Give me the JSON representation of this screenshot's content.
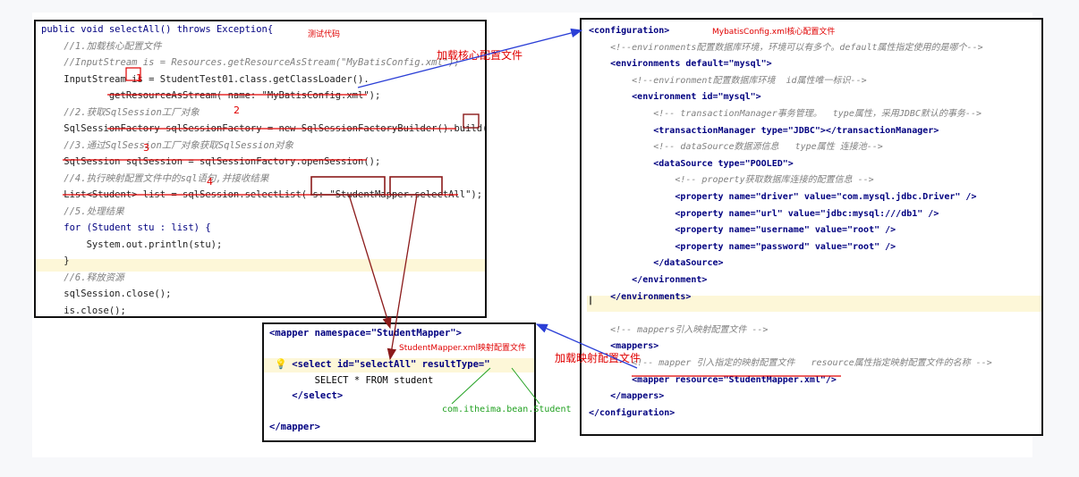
{
  "java": {
    "lines": [
      "public void selectAll() throws Exception{",
      "    //1.加载核心配置文件",
      "    //InputStream is = Resources.getResourceAsStream(\"MyBatisConfig.xml\");",
      "    InputStream is = StudentTest01.class.getClassLoader().",
      "            getResourceAsStream( name: \"MyBatisConfig.xml\");",
      "    //2.获取SqlSession工厂对象",
      "    SqlSessionFactory sqlSessionFactory = new SqlSessionFactoryBuilder().build(is);",
      "    //3.通过SqlSession工厂对象获取SqlSession对象",
      "    SqlSession sqlSession = sqlSessionFactory.openSession();",
      "    //4.执行映射配置文件中的sql语句,并接收结果",
      "    List<Student> list = sqlSession.selectList( s: \"StudentMapper.selectAll\");",
      "    //5.处理结果",
      "    for (Student stu : list) {",
      "        System.out.println(stu);",
      "    }",
      "    //6.释放资源",
      "    sqlSession.close();",
      "    is.close();",
      "}"
    ]
  },
  "config": {
    "lines": [
      "<configuration>",
      "    <!--environments配置数据库环境，环境可以有多个。default属性指定使用的是哪个-->",
      "    <environments default=\"mysql\">",
      "        <!--environment配置数据库环境  id属性唯一标识-->",
      "        <environment id=\"mysql\">",
      "            <!-- transactionManager事务管理。  type属性，采用JDBC默认的事务-->",
      "            <transactionManager type=\"JDBC\"></transactionManager>",
      "            <!-- dataSource数据源信息   type属性 连接池-->",
      "            <dataSource type=\"POOLED\">",
      "                <!-- property获取数据库连接的配置信息 -->",
      "                <property name=\"driver\" value=\"com.mysql.jdbc.Driver\" />",
      "                <property name=\"url\" value=\"jdbc:mysql:///db1\" />",
      "                <property name=\"username\" value=\"root\" />",
      "                <property name=\"password\" value=\"root\" />",
      "            </dataSource>",
      "        </environment>",
      "    </environments>",
      "",
      "    <!-- mappers引入映射配置文件 -->",
      "    <mappers>",
      "        <!-- mapper 引入指定的映射配置文件   resource属性指定映射配置文件的名称 -->",
      "        <mapper resource=\"StudentMapper.xml\"/>",
      "    </mappers>",
      "</configuration>"
    ]
  },
  "mapper": {
    "lines": [
      "<mapper namespace=\"StudentMapper\">",
      "",
      "    <select id=\"selectAll\" resultType=\"              \">",
      "        SELECT * FROM student",
      "    </select>",
      "",
      "</mapper>"
    ]
  },
  "labels": {
    "test_code": "测试代码",
    "load_core_config": "加载核心配置文件",
    "config_file_title": "MybatisConfig.xml核心配置文件",
    "mapper_file_title": "StudentMapper.xml映射配置文件",
    "load_mapper_config": "加载映射配置文件",
    "bean_class": "com.itheima.bean.Student",
    "step_1": "1",
    "step_2": "2",
    "step_3": "3",
    "step_4": "4"
  },
  "colors": {
    "annotation_red": "#e00000",
    "arrow_blue": "#2b3fd6",
    "arrow_darkred": "#8b1a1a",
    "bean_green": "#20a020"
  }
}
